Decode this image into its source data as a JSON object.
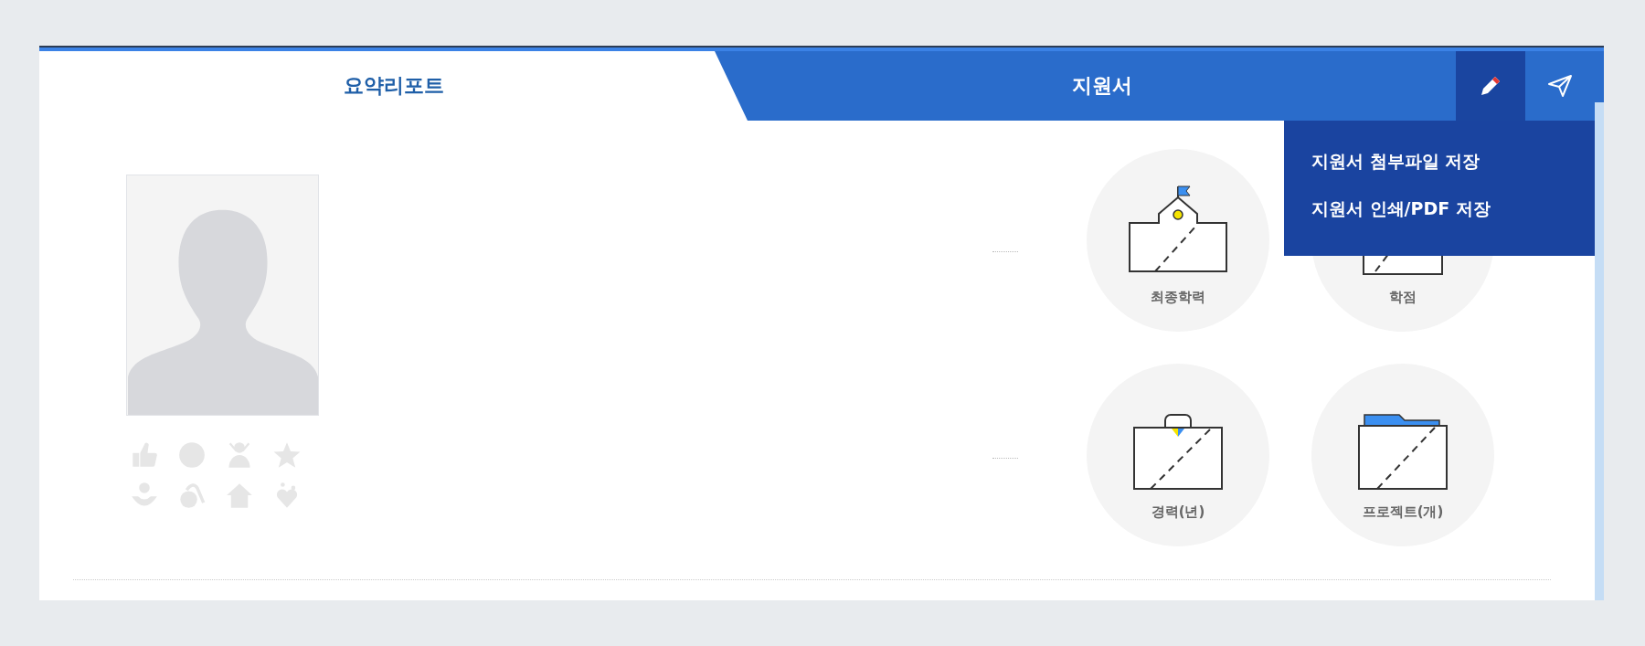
{
  "tabs": [
    {
      "label": "요약리포트",
      "selected": true
    },
    {
      "label": "지원서",
      "selected": false
    }
  ],
  "toolbar": [
    {
      "kind": "edit"
    },
    {
      "kind": "send"
    }
  ],
  "menu": {
    "items": [
      "지원서 첨부파일 저장",
      "지원서 인쇄/PDF 저장"
    ]
  },
  "profile": {
    "photo": {
      "kind": "avatar"
    },
    "badges": [
      {
        "kind": "thumbs-up",
        "active": false
      },
      {
        "kind": "circle",
        "active": false
      },
      {
        "kind": "person",
        "active": false
      },
      {
        "kind": "star",
        "active": false
      },
      {
        "kind": "child",
        "active": false
      },
      {
        "kind": "wheelchair",
        "active": false
      },
      {
        "kind": "house",
        "active": false
      },
      {
        "kind": "heart",
        "active": false
      }
    ]
  },
  "stats": [
    {
      "kind": "school",
      "label": "최종학력"
    },
    {
      "kind": "paper",
      "label": "학점"
    },
    {
      "kind": "briefcase",
      "label": "경력(년)"
    },
    {
      "kind": "folder",
      "label": "프로젝트(개)"
    }
  ]
}
